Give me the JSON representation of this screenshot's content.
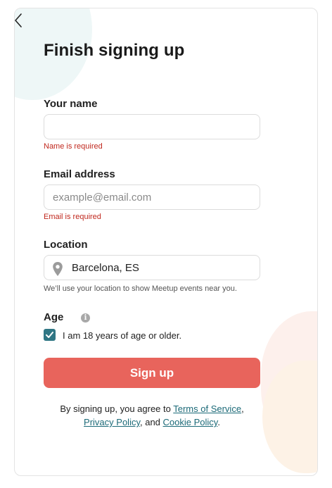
{
  "header": {
    "title": "Finish signing up"
  },
  "form": {
    "name": {
      "label": "Your name",
      "value": "",
      "placeholder": "",
      "error": "Name is required"
    },
    "email": {
      "label": "Email address",
      "value": "",
      "placeholder": "example@email.com",
      "error": "Email is required"
    },
    "location": {
      "label": "Location",
      "value": "Barcelona, ES",
      "hint": "We’ll use your location to show Meetup events near you."
    },
    "age": {
      "label": "Age",
      "checkbox_label": "I am 18 years of age or older.",
      "checked": true
    }
  },
  "signup_button": {
    "label": "Sign up",
    "color": "#e8645c"
  },
  "legal": {
    "prefix": "By signing up, you agree to ",
    "terms": "Terms of Service",
    "comma": ",",
    "privacy": "Privacy Policy",
    "and": ", and ",
    "cookie": "Cookie Policy",
    "end": "."
  },
  "colors": {
    "accent": "#2f7684",
    "error": "#c0281e",
    "link": "#1c6a78"
  },
  "icons": {
    "back": "chevron-left-icon",
    "location": "map-pin-icon",
    "info": "info-icon",
    "check": "check-icon"
  }
}
